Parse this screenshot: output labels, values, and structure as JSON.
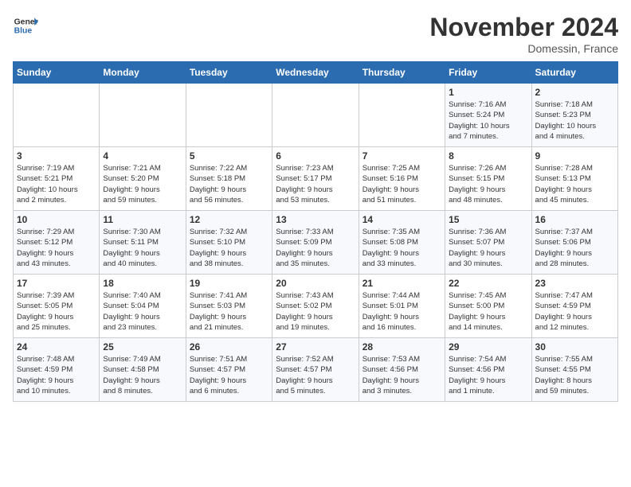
{
  "header": {
    "logo_line1": "General",
    "logo_line2": "Blue",
    "month": "November 2024",
    "location": "Domessin, France"
  },
  "weekdays": [
    "Sunday",
    "Monday",
    "Tuesday",
    "Wednesday",
    "Thursday",
    "Friday",
    "Saturday"
  ],
  "weeks": [
    [
      {
        "day": "",
        "content": ""
      },
      {
        "day": "",
        "content": ""
      },
      {
        "day": "",
        "content": ""
      },
      {
        "day": "",
        "content": ""
      },
      {
        "day": "",
        "content": ""
      },
      {
        "day": "1",
        "content": "Sunrise: 7:16 AM\nSunset: 5:24 PM\nDaylight: 10 hours\nand 7 minutes."
      },
      {
        "day": "2",
        "content": "Sunrise: 7:18 AM\nSunset: 5:23 PM\nDaylight: 10 hours\nand 4 minutes."
      }
    ],
    [
      {
        "day": "3",
        "content": "Sunrise: 7:19 AM\nSunset: 5:21 PM\nDaylight: 10 hours\nand 2 minutes."
      },
      {
        "day": "4",
        "content": "Sunrise: 7:21 AM\nSunset: 5:20 PM\nDaylight: 9 hours\nand 59 minutes."
      },
      {
        "day": "5",
        "content": "Sunrise: 7:22 AM\nSunset: 5:18 PM\nDaylight: 9 hours\nand 56 minutes."
      },
      {
        "day": "6",
        "content": "Sunrise: 7:23 AM\nSunset: 5:17 PM\nDaylight: 9 hours\nand 53 minutes."
      },
      {
        "day": "7",
        "content": "Sunrise: 7:25 AM\nSunset: 5:16 PM\nDaylight: 9 hours\nand 51 minutes."
      },
      {
        "day": "8",
        "content": "Sunrise: 7:26 AM\nSunset: 5:15 PM\nDaylight: 9 hours\nand 48 minutes."
      },
      {
        "day": "9",
        "content": "Sunrise: 7:28 AM\nSunset: 5:13 PM\nDaylight: 9 hours\nand 45 minutes."
      }
    ],
    [
      {
        "day": "10",
        "content": "Sunrise: 7:29 AM\nSunset: 5:12 PM\nDaylight: 9 hours\nand 43 minutes."
      },
      {
        "day": "11",
        "content": "Sunrise: 7:30 AM\nSunset: 5:11 PM\nDaylight: 9 hours\nand 40 minutes."
      },
      {
        "day": "12",
        "content": "Sunrise: 7:32 AM\nSunset: 5:10 PM\nDaylight: 9 hours\nand 38 minutes."
      },
      {
        "day": "13",
        "content": "Sunrise: 7:33 AM\nSunset: 5:09 PM\nDaylight: 9 hours\nand 35 minutes."
      },
      {
        "day": "14",
        "content": "Sunrise: 7:35 AM\nSunset: 5:08 PM\nDaylight: 9 hours\nand 33 minutes."
      },
      {
        "day": "15",
        "content": "Sunrise: 7:36 AM\nSunset: 5:07 PM\nDaylight: 9 hours\nand 30 minutes."
      },
      {
        "day": "16",
        "content": "Sunrise: 7:37 AM\nSunset: 5:06 PM\nDaylight: 9 hours\nand 28 minutes."
      }
    ],
    [
      {
        "day": "17",
        "content": "Sunrise: 7:39 AM\nSunset: 5:05 PM\nDaylight: 9 hours\nand 25 minutes."
      },
      {
        "day": "18",
        "content": "Sunrise: 7:40 AM\nSunset: 5:04 PM\nDaylight: 9 hours\nand 23 minutes."
      },
      {
        "day": "19",
        "content": "Sunrise: 7:41 AM\nSunset: 5:03 PM\nDaylight: 9 hours\nand 21 minutes."
      },
      {
        "day": "20",
        "content": "Sunrise: 7:43 AM\nSunset: 5:02 PM\nDaylight: 9 hours\nand 19 minutes."
      },
      {
        "day": "21",
        "content": "Sunrise: 7:44 AM\nSunset: 5:01 PM\nDaylight: 9 hours\nand 16 minutes."
      },
      {
        "day": "22",
        "content": "Sunrise: 7:45 AM\nSunset: 5:00 PM\nDaylight: 9 hours\nand 14 minutes."
      },
      {
        "day": "23",
        "content": "Sunrise: 7:47 AM\nSunset: 4:59 PM\nDaylight: 9 hours\nand 12 minutes."
      }
    ],
    [
      {
        "day": "24",
        "content": "Sunrise: 7:48 AM\nSunset: 4:59 PM\nDaylight: 9 hours\nand 10 minutes."
      },
      {
        "day": "25",
        "content": "Sunrise: 7:49 AM\nSunset: 4:58 PM\nDaylight: 9 hours\nand 8 minutes."
      },
      {
        "day": "26",
        "content": "Sunrise: 7:51 AM\nSunset: 4:57 PM\nDaylight: 9 hours\nand 6 minutes."
      },
      {
        "day": "27",
        "content": "Sunrise: 7:52 AM\nSunset: 4:57 PM\nDaylight: 9 hours\nand 5 minutes."
      },
      {
        "day": "28",
        "content": "Sunrise: 7:53 AM\nSunset: 4:56 PM\nDaylight: 9 hours\nand 3 minutes."
      },
      {
        "day": "29",
        "content": "Sunrise: 7:54 AM\nSunset: 4:56 PM\nDaylight: 9 hours\nand 1 minute."
      },
      {
        "day": "30",
        "content": "Sunrise: 7:55 AM\nSunset: 4:55 PM\nDaylight: 8 hours\nand 59 minutes."
      }
    ]
  ]
}
